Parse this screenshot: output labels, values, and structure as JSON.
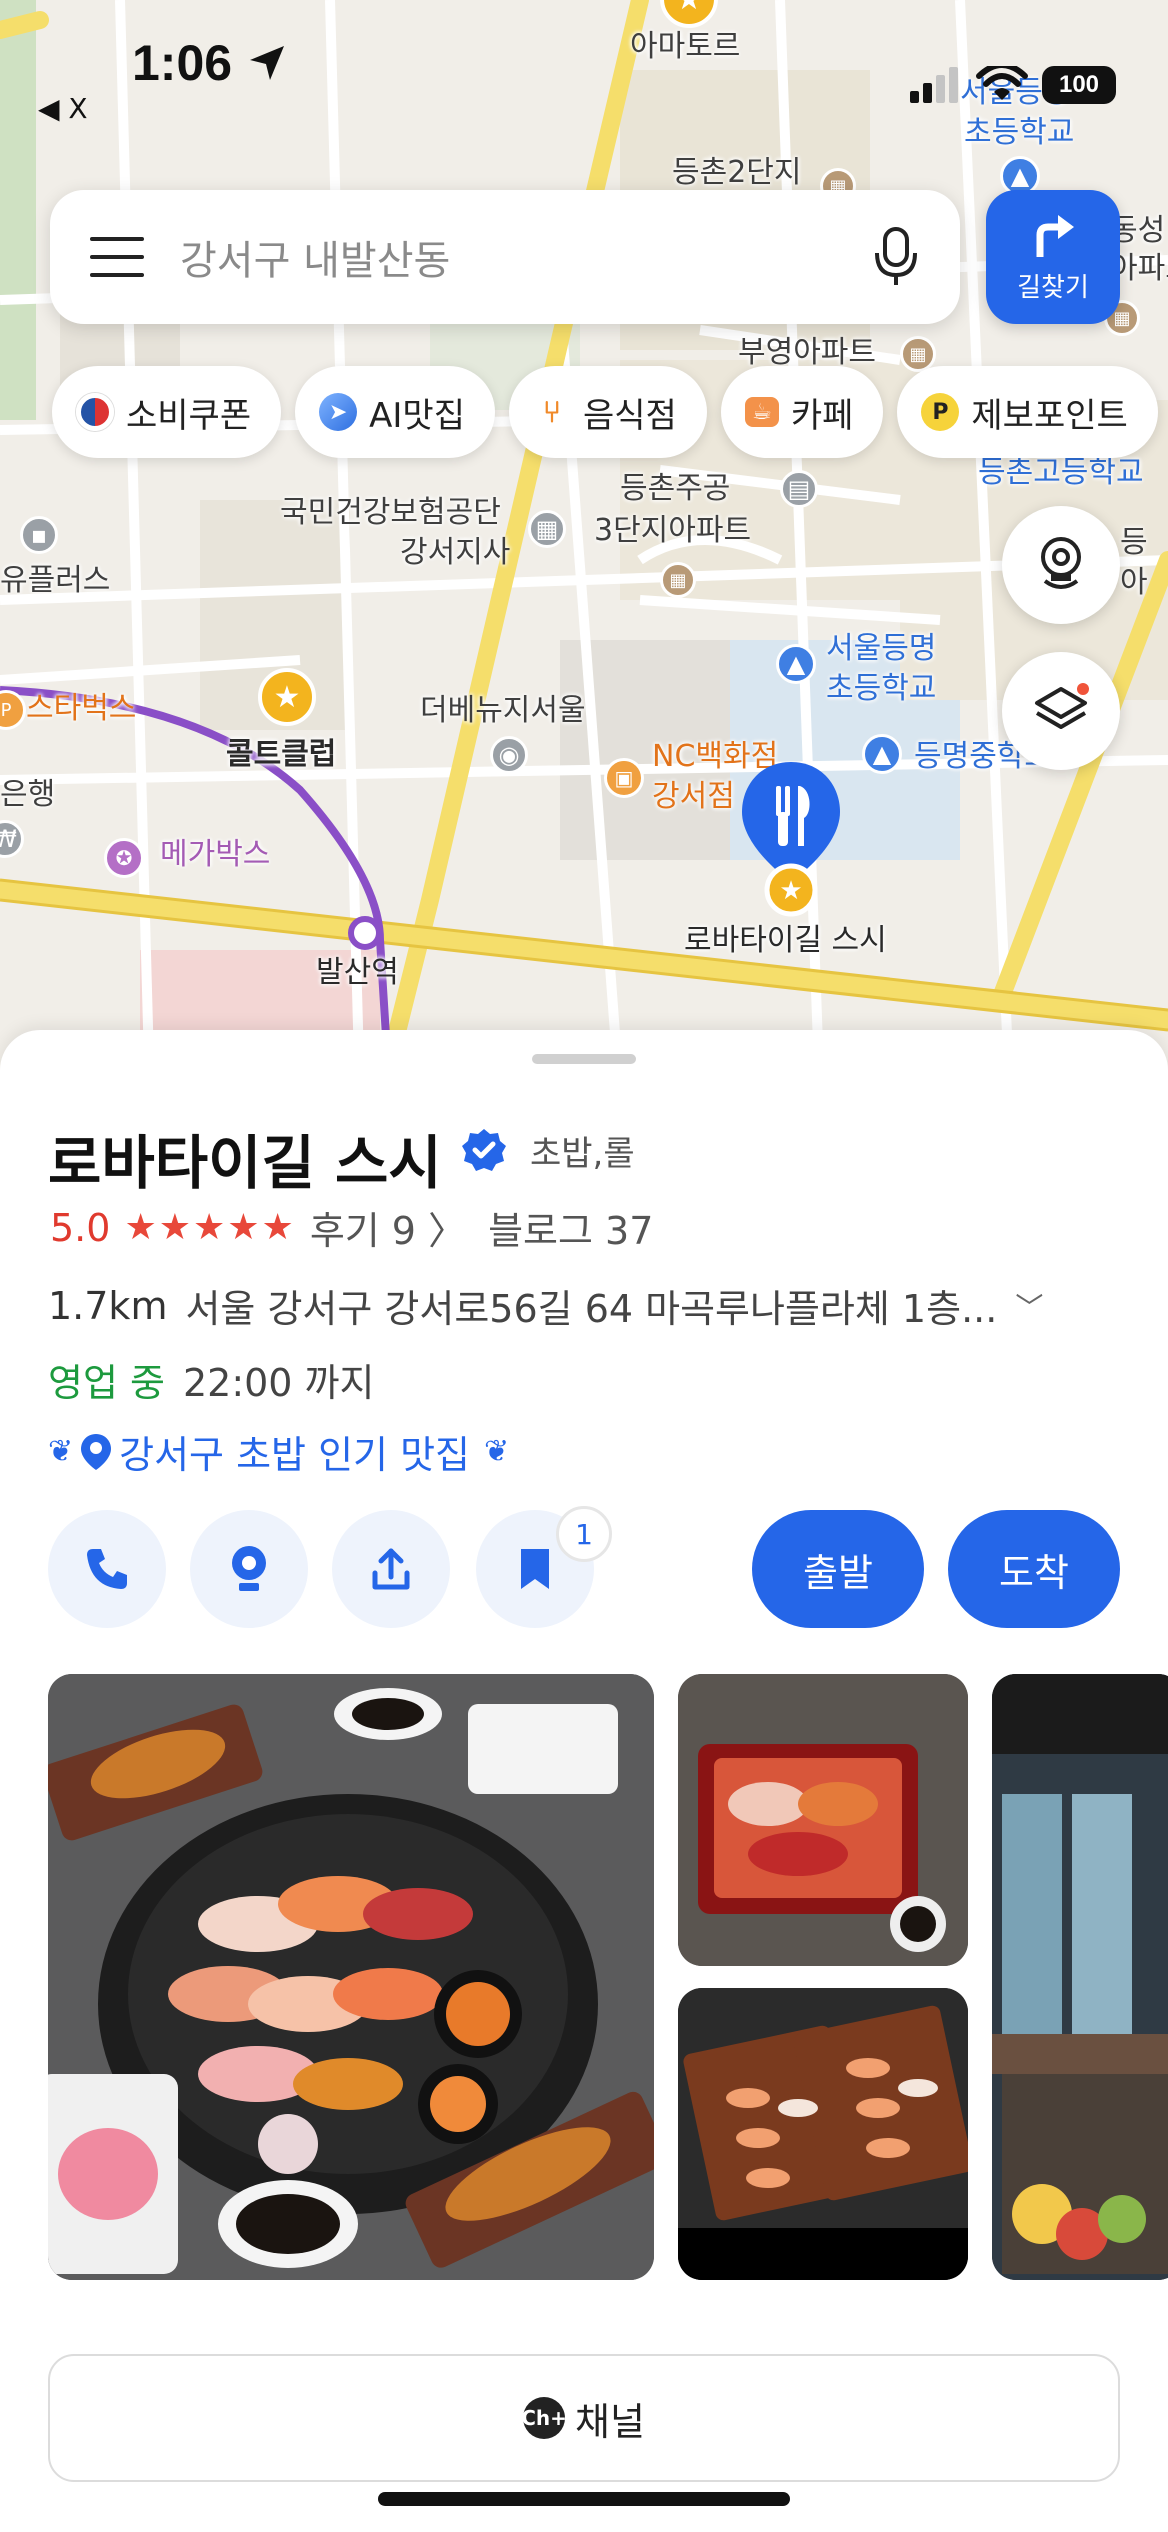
{
  "status_bar": {
    "time": "1:06",
    "back_label": "◀ X",
    "battery": "100"
  },
  "search": {
    "placeholder": "강서구 내발산동"
  },
  "route_button": {
    "label": "길찾기"
  },
  "chips": [
    {
      "label": "소비쿠폰",
      "icon": "korea-flag-icon"
    },
    {
      "label": "AI맛집",
      "icon": "compass-icon"
    },
    {
      "label": "음식점",
      "icon": "utensils-icon"
    },
    {
      "label": "카페",
      "icon": "coffee-cup-icon"
    },
    {
      "label": "제보포인트",
      "icon": "points-p-icon"
    }
  ],
  "map_labels": {
    "amatory": "아마토르",
    "school1": "서울등양",
    "school1b": "초등학교",
    "apt2": "등촌2단지",
    "dong_a": "동성",
    "dong_b": "아파트",
    "buyoung": "부영아파트",
    "deungchon_high": "등촌고등학교",
    "deungchon_sp": "등",
    "nhis_1": "국민건강보험공단",
    "nhis_2": "강서지사",
    "jugong_1": "등촌주공",
    "jugong_2": "3단지아파트",
    "yuplus": "유플러스",
    "deung_right": "등",
    "deung_right2": "아",
    "starbucks": "스타벅스",
    "bank": "은행",
    "coltclub": "콜트클럽",
    "thenew": "더베뉴지서울",
    "seoul_deungmyeong_1": "서울등명",
    "seoul_deungmyeong_2": "초등학교",
    "deungmyeong_mid": "등명중학교",
    "nc_1": "NC백화점",
    "nc_2": "강서점",
    "megabox": "메가박스",
    "balsan": "발산역",
    "selected_place": "로바타이길 스시",
    "gong": "등"
  },
  "place": {
    "name": "로바타이길 스시",
    "category": "초밥,롤",
    "rating": "5.0",
    "stars": "★★★★★",
    "reviews": "후기 9 〉",
    "blogs": "블로그 37",
    "distance": "1.7km",
    "address": "서울 강서구 강서로56길 64 마곡루나플라체 1층...",
    "open_status": "영업 중",
    "hours": "22:00 까지",
    "badge": "강서구 초밥 인기 맛집",
    "saved_count": "1"
  },
  "actions": {
    "depart": "출발",
    "arrive": "도착"
  },
  "channel_button": {
    "badge": "Ch+",
    "label": "채널"
  },
  "colors": {
    "accent": "#2566e8",
    "open": "#1d9a3e",
    "rating": "#e03a2e"
  }
}
